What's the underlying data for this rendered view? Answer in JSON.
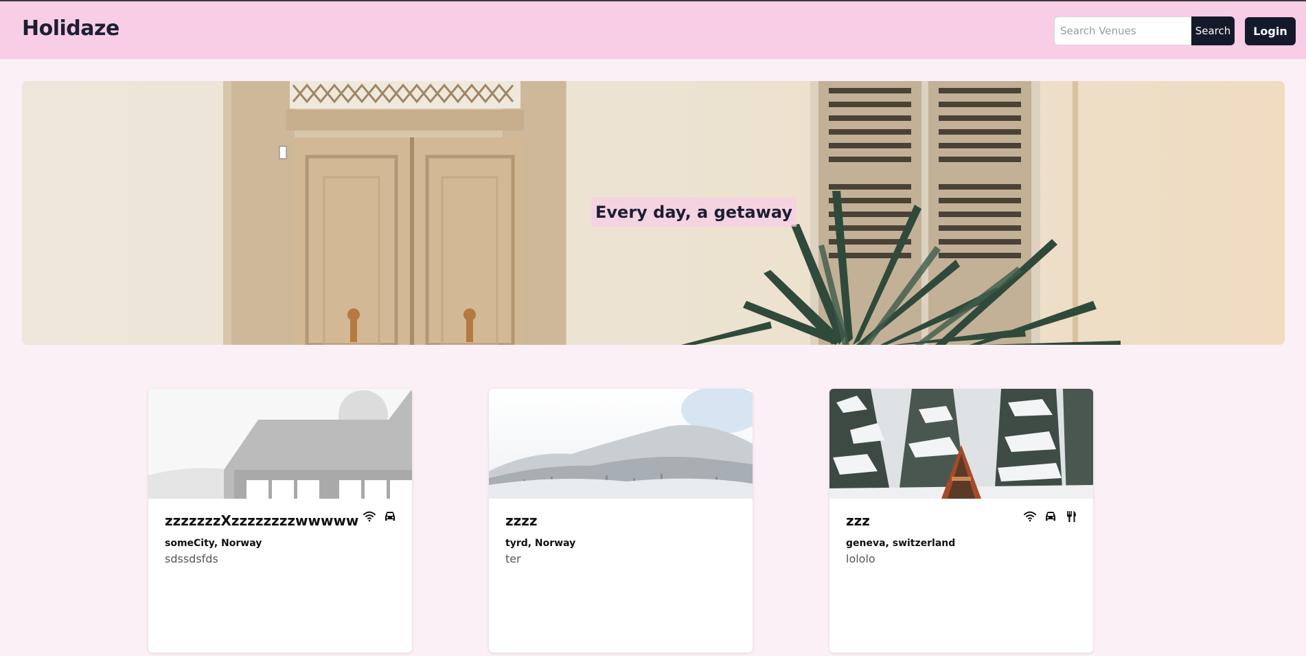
{
  "header": {
    "brand": "Holidaze",
    "search_placeholder": "Search Venues",
    "search_label": "Search",
    "login_label": "Login"
  },
  "hero": {
    "title": "Every day, a getaway"
  },
  "venues": [
    {
      "name": "zzzzzzzXzzzzzzzzwwwww",
      "location": "someCity, Norway",
      "description": "sdssdsfds",
      "amenities": [
        "wifi-icon",
        "parking-icon"
      ]
    },
    {
      "name": "zzzz",
      "location": "tyrd, Norway",
      "description": "ter",
      "amenities": []
    },
    {
      "name": "zzz",
      "location": "geneva, switzerland",
      "description": "lololo",
      "amenities": [
        "wifi-icon",
        "parking-icon",
        "restaurant-icon"
      ]
    }
  ],
  "colors": {
    "header_bg": "#f8cde6",
    "page_bg": "#fcf0f7",
    "button_bg": "#151a2b"
  }
}
